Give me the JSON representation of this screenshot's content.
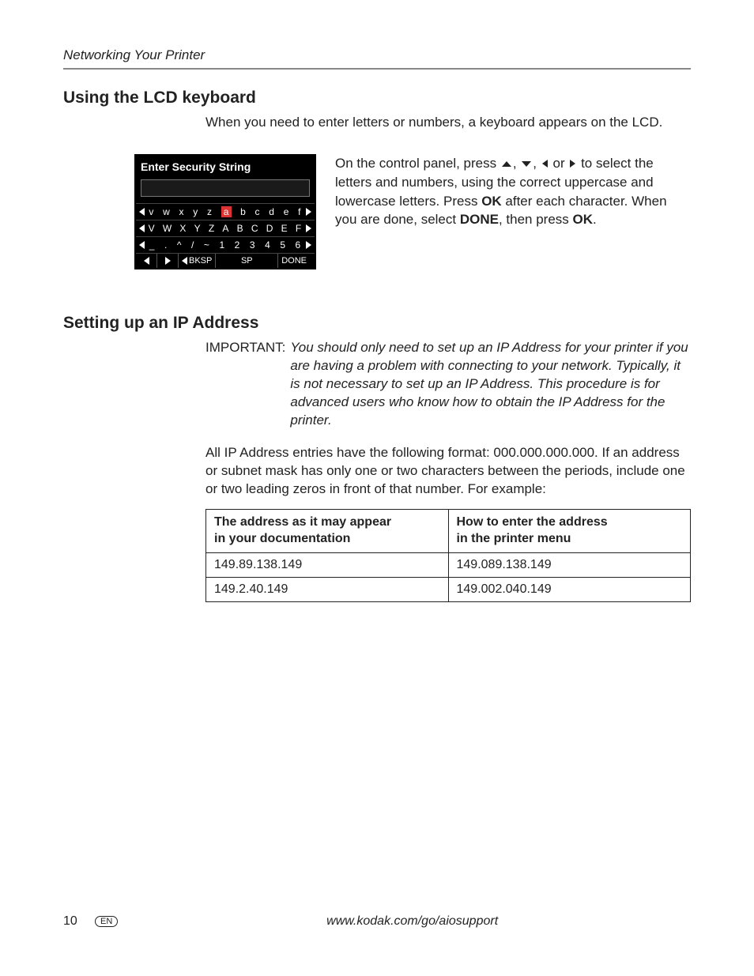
{
  "runningHead": "Networking Your Printer",
  "section1": {
    "heading": "Using the LCD keyboard",
    "intro": "When you need to enter letters or numbers, a keyboard appears on the LCD.",
    "lcd": {
      "title": "Enter Security String",
      "row1": [
        "v",
        "w",
        "x",
        "y",
        "z",
        "a",
        "b",
        "c",
        "d",
        "e",
        "f"
      ],
      "row1_highlight_index": 5,
      "row2": [
        "V",
        "W",
        "X",
        "Y",
        "Z",
        "A",
        "B",
        "C",
        "D",
        "E",
        "F"
      ],
      "row3": [
        "_",
        ".",
        "^",
        "/",
        "~",
        "1",
        "2",
        "3",
        "4",
        "5",
        "6"
      ],
      "bksp": "BKSP",
      "sp": "SP",
      "done": "DONE"
    },
    "para_a": "On the control panel, press ",
    "para_b": " or ",
    "para_c": " to select the letters and numbers, using the correct uppercase and lowercase letters. Press ",
    "ok1": "OK",
    "para_d": " after each character. When you are done, select ",
    "doneWord": "DONE",
    "para_e": ", then press ",
    "ok2": "OK",
    "period": "."
  },
  "section2": {
    "heading": "Setting up an IP Address",
    "importantLabel": "IMPORTANT:",
    "importantText": "You should only need to set up an IP Address for your printer if you are having a problem with connecting to your network. Typically, it is not necessary to set up an IP Address. This procedure is for advanced users who know how to obtain the IP Address for the printer.",
    "para": "All IP Address entries have the following format: 000.000.000.000. If an address or subnet mask has only one or two characters between the periods, include one or two leading zeros in front of that number. For example:",
    "table": {
      "h1a": "The address as it may appear",
      "h1b": "in your documentation",
      "h2a": "How to enter the address",
      "h2b": "in the printer menu",
      "r1c1": "149.89.138.149",
      "r1c2": "149.089.138.149",
      "r2c1": "149.2.40.149",
      "r2c2": "149.002.040.149"
    }
  },
  "footer": {
    "page": "10",
    "lang": "EN",
    "url": "www.kodak.com/go/aiosupport"
  }
}
